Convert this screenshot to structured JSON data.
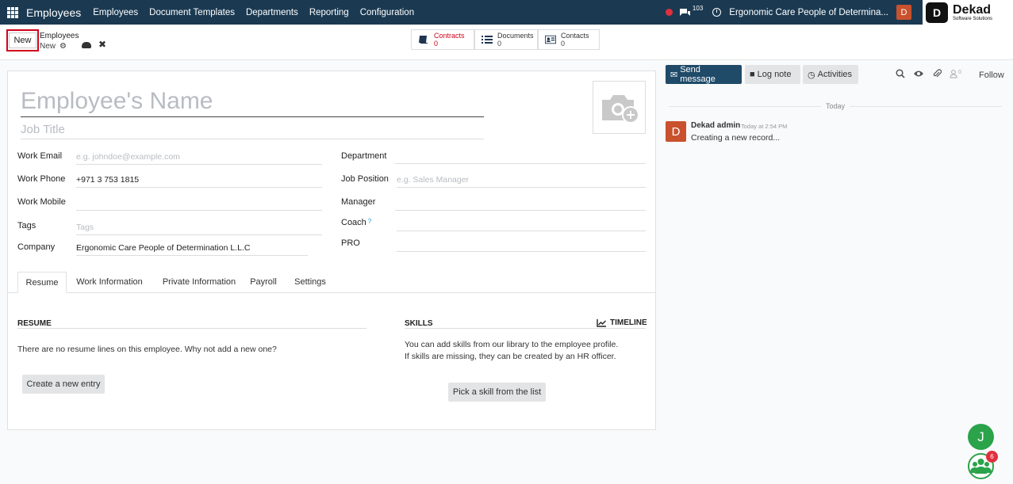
{
  "nav": {
    "app_name": "Employees",
    "menu": [
      "Employees",
      "Document Templates",
      "Departments",
      "Reporting",
      "Configuration"
    ],
    "chat_count": "103",
    "company": "Ergonomic Care People of Determina...",
    "user_initial": "D",
    "brand_name": "Dekad",
    "brand_sub": "Software Solutions",
    "brand_logo": "D"
  },
  "control": {
    "new_label": "New",
    "breadcrumb_parent": "Employees",
    "breadcrumb_current": "New",
    "smart_buttons": [
      {
        "label": "Contracts",
        "count": "0",
        "icon": "book-icon",
        "color": "#d0021b"
      },
      {
        "label": "Documents",
        "count": "0",
        "icon": "list-icon",
        "color": "#333333"
      },
      {
        "label": "Contacts",
        "count": "0",
        "icon": "contact-card-icon",
        "color": "#333333"
      }
    ]
  },
  "form": {
    "name_placeholder": "Employee's Name",
    "job_title_placeholder": "Job Title",
    "left_fields": [
      {
        "label": "Work Email",
        "value": "",
        "placeholder": "e.g. johndoe@example.com"
      },
      {
        "label": "Work Phone",
        "value": "+971 3 753 1815",
        "placeholder": ""
      },
      {
        "label": "Work Mobile",
        "value": "",
        "placeholder": ""
      },
      {
        "label": "Tags",
        "value": "",
        "placeholder": "Tags"
      },
      {
        "label": "Company",
        "value": "Ergonomic Care People of Determination L.L.C",
        "placeholder": ""
      }
    ],
    "right_fields": [
      {
        "label": "Department",
        "value": "",
        "placeholder": ""
      },
      {
        "label": "Job Position",
        "value": "",
        "placeholder": "e.g. Sales Manager"
      },
      {
        "label": "Manager",
        "value": "",
        "placeholder": ""
      },
      {
        "label": "Coach",
        "value": "",
        "placeholder": "",
        "help": "?"
      },
      {
        "label": "PRO",
        "value": "",
        "placeholder": ""
      }
    ],
    "tabs": [
      "Resume",
      "Work Information",
      "Private Information",
      "Payroll",
      "Settings"
    ],
    "active_tab": "Resume",
    "resume": {
      "title": "RESUME",
      "empty_text": "There are no resume lines on this employee. Why not add a new one?",
      "button": "Create a new entry"
    },
    "skills": {
      "title": "SKILLS",
      "timeline_label": "TIMELINE",
      "text_line1": "You can add skills from our library to the employee profile.",
      "text_line2": "If skills are missing, they can be created by an HR officer.",
      "button": "Pick a skill from the list"
    }
  },
  "chatter": {
    "send_message": "Send message",
    "log_note": "Log note",
    "activities": "Activities",
    "follower_count": "0",
    "follow": "Follow",
    "date_separator": "Today",
    "message": {
      "author_initial": "D",
      "author": "Dekad admin",
      "time": "Today at 2:54 PM",
      "body": "Creating a new record..."
    }
  },
  "floating": {
    "user_initial": "J",
    "badge_count": "6"
  },
  "colors": {
    "navbar": "#1b3a52",
    "primary_button": "#1f4a68",
    "avatar": "#c9512e",
    "alert": "#d0021b",
    "online": "#2aa34a"
  }
}
